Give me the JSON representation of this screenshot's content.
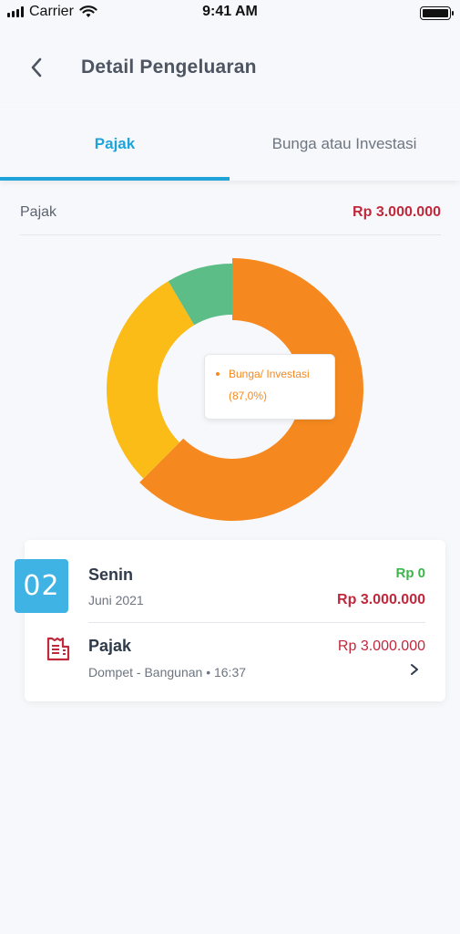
{
  "status_bar": {
    "carrier": "Carrier",
    "time": "9:41 AM",
    "icons": [
      "signal-icon",
      "wifi-icon",
      "battery-icon"
    ]
  },
  "header": {
    "title": "Detail Pengeluaran",
    "back_icon": "chevron-left-icon"
  },
  "tabs": [
    {
      "label": "Pajak",
      "active": true
    },
    {
      "label": "Bunga atau Investasi",
      "active": false
    }
  ],
  "summary": {
    "label": "Pajak",
    "amount": "Rp 3.000.000"
  },
  "chart_data": {
    "type": "pie",
    "categories": [
      "Bunga/ Investasi",
      "Yellow segment",
      "Green segment"
    ],
    "values": [
      62.5,
      29.0,
      8.5
    ],
    "colors": [
      "#f5891f",
      "#fbbc17",
      "#5dbd87"
    ],
    "tooltip": {
      "label": "Bunga/ Investasi",
      "value": "(87,0%)"
    }
  },
  "card": {
    "date_number": "02",
    "day_name": "Senin",
    "month_year": "Juni 2021",
    "income": "Rp 0",
    "expense_total": "Rp 3.000.000",
    "transaction": {
      "name": "Pajak",
      "meta": "Dompet - Bangunan • 16:37",
      "amount": "Rp 3.000.000",
      "icon": "receipt-icon"
    }
  },
  "colors": {
    "accent": "#1fa3d9",
    "expense": "#c0283c",
    "income": "#3cb54a",
    "badge": "#3fb3e3"
  }
}
